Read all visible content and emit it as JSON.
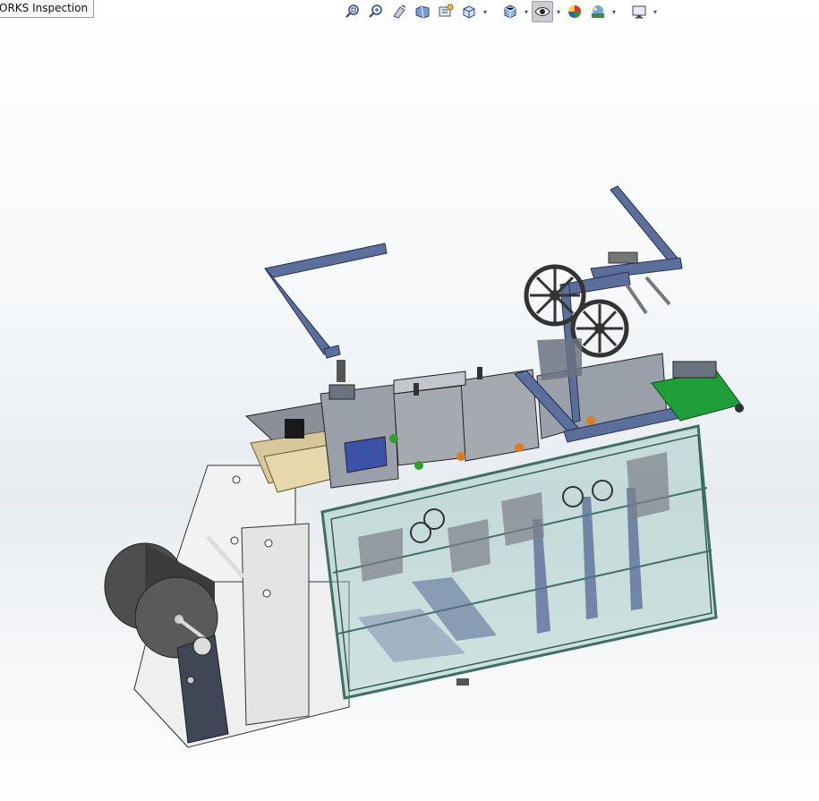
{
  "document_tab": {
    "label": "ORKS Inspection"
  },
  "heads_up_toolbar": {
    "buttons": [
      {
        "icon": "zoom-to-fit-icon"
      },
      {
        "icon": "zoom-to-area-icon"
      },
      {
        "icon": "previous-view-icon"
      },
      {
        "icon": "section-view-icon"
      },
      {
        "icon": "dynamic-annotation-icon"
      },
      {
        "icon": "view-orientation-icon",
        "dropdown": true
      },
      {
        "icon": "display-style-icon",
        "dropdown": true
      },
      {
        "icon": "hide-show-items-icon",
        "dropdown": true,
        "active": true
      },
      {
        "icon": "edit-appearance-icon"
      },
      {
        "icon": "apply-scene-icon",
        "dropdown": true
      },
      {
        "icon": "view-settings-icon",
        "dropdown": true
      }
    ]
  },
  "model": {
    "name": "",
    "colors": {
      "frame": "#5b6f9a",
      "gray": "#8a8f98",
      "belt": "#1f9e3a",
      "glass": "#9ec7bf"
    }
  }
}
